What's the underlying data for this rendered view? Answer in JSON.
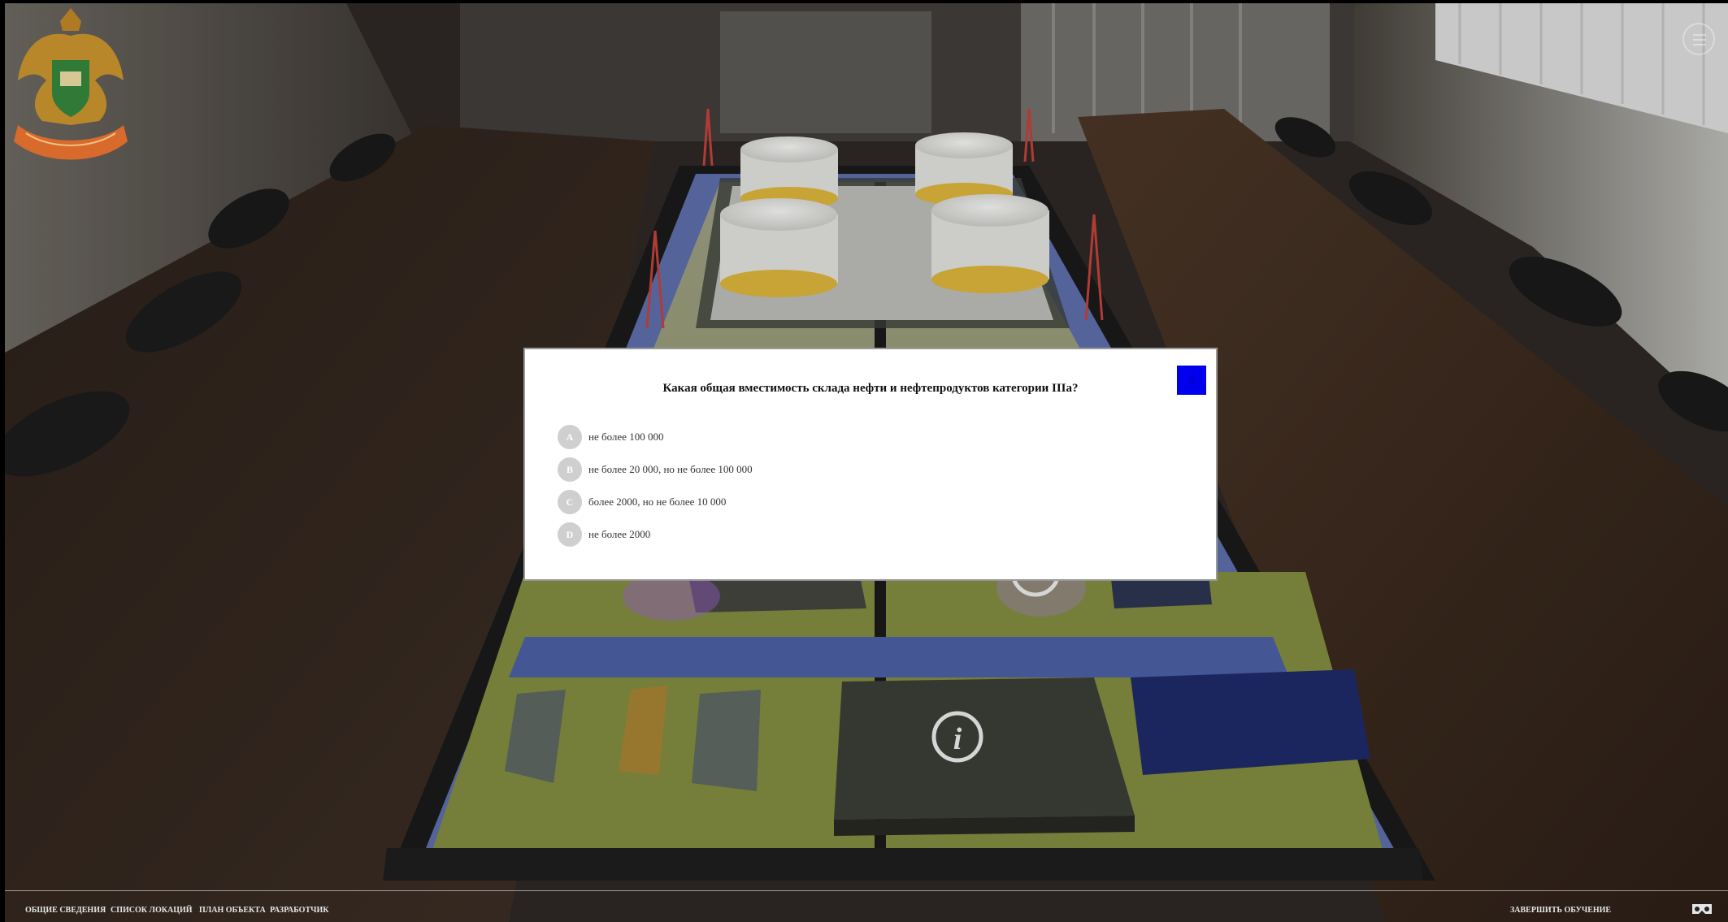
{
  "quiz": {
    "question": "Какая общая вместимость склада нефти и нефтепродуктов категории IIIа?",
    "close_label": "x",
    "answers": [
      {
        "letter": "A",
        "text": "не более 100 000"
      },
      {
        "letter": "B",
        "text": "не более 20 000, но не более 100 000"
      },
      {
        "letter": "C",
        "text": "более 2000, но не более 10 000"
      },
      {
        "letter": "D",
        "text": "не более 2000"
      }
    ]
  },
  "bottom_nav": {
    "items": [
      {
        "label": "ОБЩИЕ СВЕДЕНИЯ"
      },
      {
        "label": "СПИСОК ЛОКАЦИЙ"
      },
      {
        "label": "ПЛАН ОБЪЕКТА"
      },
      {
        "label": "РАЗРАБОТЧИК"
      }
    ],
    "finish_label": "ЗАВЕРШИТЬ ОБУЧЕНИЕ"
  },
  "icons": {
    "menu": "hamburger-icon",
    "vr": "vr-headset-icon",
    "info": "info-icon",
    "logo": "emergency-ministry-emblem"
  },
  "colors": {
    "close_button": "#0000ee",
    "answer_circle": "#cfcfcf",
    "modal_background": "#ffffff"
  }
}
